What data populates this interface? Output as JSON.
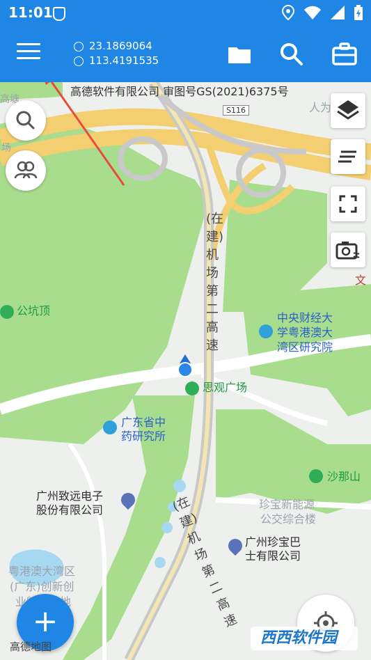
{
  "status_bar": {
    "time": "11:01"
  },
  "toolbar": {
    "latitude": "23.1869064",
    "longitude": "113.4191535",
    "icons": [
      "menu-icon",
      "folder-icon",
      "search-icon",
      "toolbox-icon"
    ]
  },
  "map": {
    "copyright": "高德软件有限公司 审图号GS(2021)6375号",
    "road_shield": "S116",
    "labels": {
      "gaotang": "高塘",
      "chang": "场",
      "gongkengding": "公坑顶",
      "renwei": "人为",
      "wen": "文",
      "cufe_line1": "中央财经大",
      "cufe_line2": "学粤港澳大",
      "cufe_line3": "湾区研究院",
      "siguan_square": "思观广场",
      "tcm_line1": "广东省中",
      "tcm_line2": "药研究所",
      "shanashan": "沙那山",
      "zhiyuan_line1": "广州致远电子",
      "zhiyuan_line2": "股份有限公司",
      "zhenbao_ne_line1": "珍宝新能源",
      "zhenbao_ne_line2": "公交综合楼",
      "zhenbao_bus_line1": "广州珍宝巴",
      "zhenbao_bus_line2": "士有限公司",
      "gba_line1": "粤港澳大湾区",
      "gba_line2": "(广东)创新创",
      "gba_line3": "业孵化基地",
      "highway_top": "(在建)机场第二高速",
      "highway_bottom": "(在建)机场第二高速"
    },
    "logo_text": "高德地图",
    "watermark": "西西软件园"
  },
  "controls": {
    "left": [
      "search-icon",
      "group-icon"
    ],
    "right": [
      "layers-icon",
      "list-icon",
      "fullscreen-icon",
      "camera-icon"
    ],
    "fab_label": "+",
    "locate": "locate-icon"
  },
  "colors": {
    "primary": "#1f86e5",
    "park": "#a9dd8e",
    "highway": "#f4cf72",
    "rail": "#c9c9c9",
    "water": "#a6d8f2",
    "arrow": "#e74c3c"
  }
}
